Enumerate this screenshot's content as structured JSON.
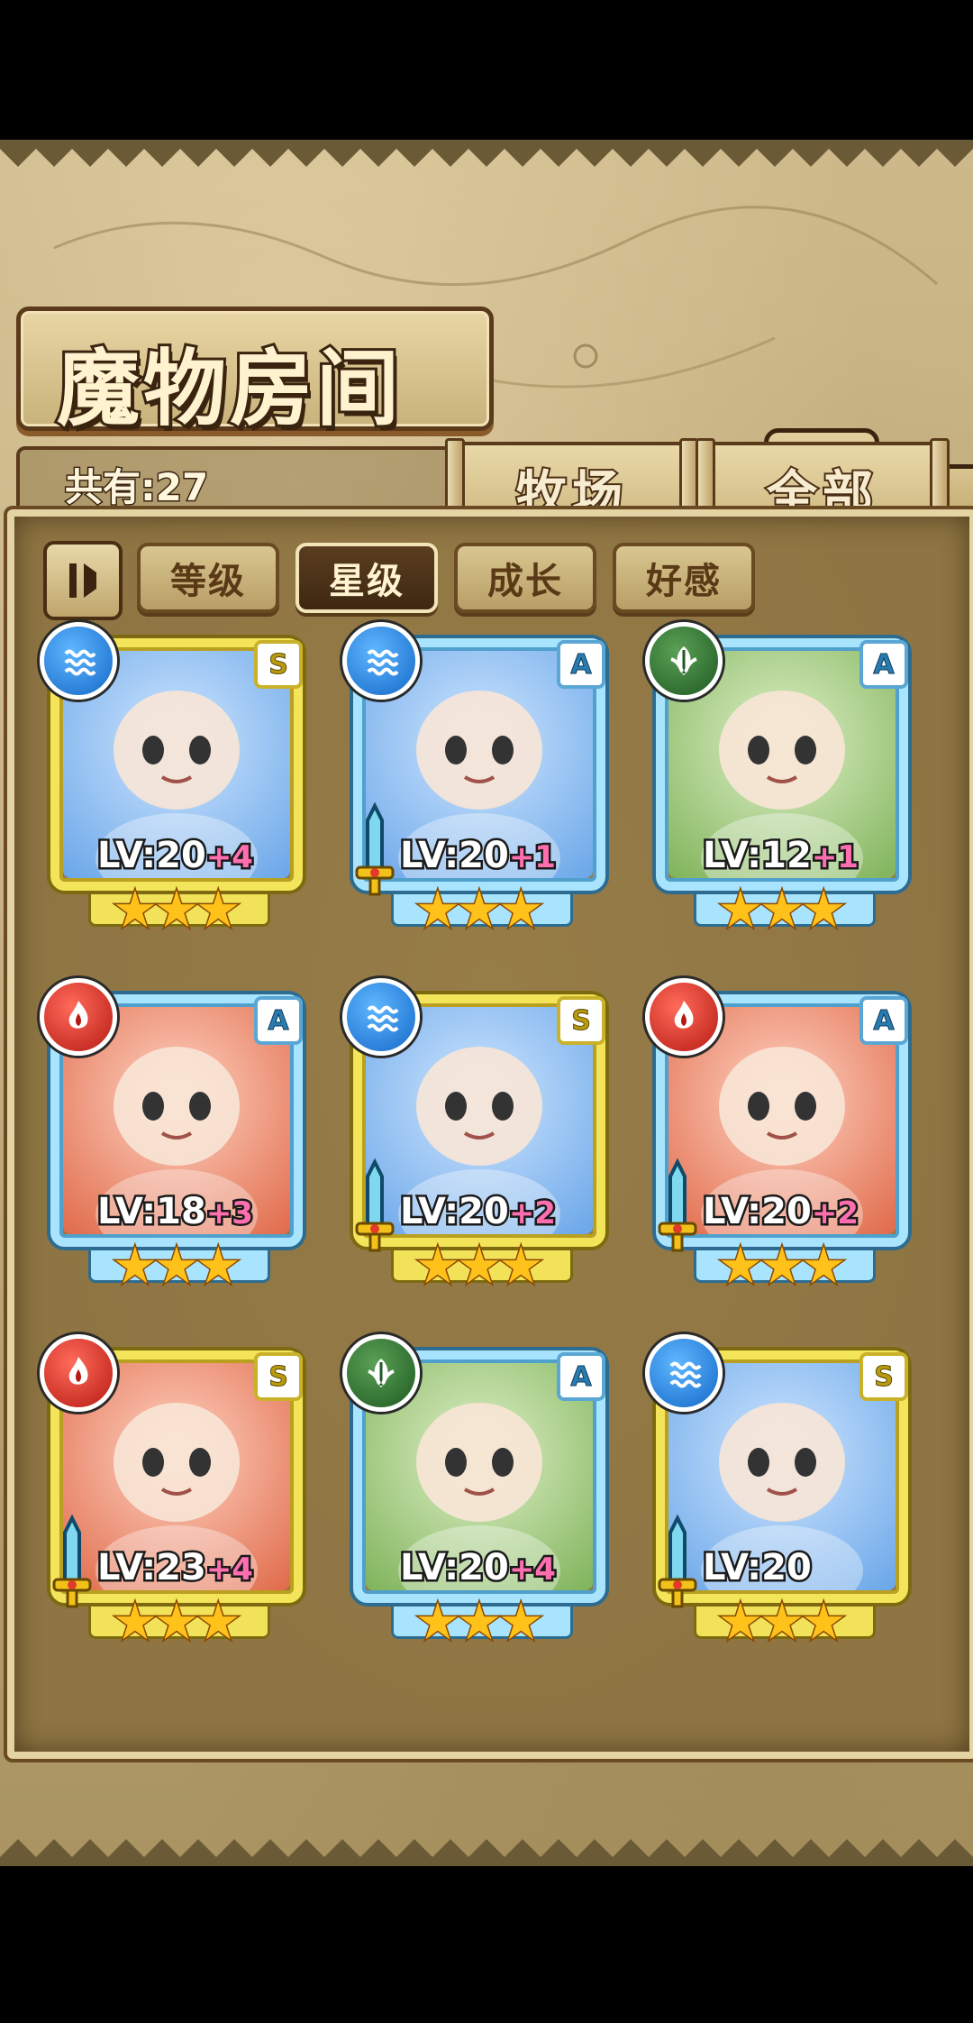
{
  "title": "魔物房间",
  "count_label": "共有:27",
  "tabs": [
    {
      "label": "牧场"
    },
    {
      "label": "全部"
    }
  ],
  "filters": [
    {
      "label": "等级",
      "active": false
    },
    {
      "label": "星级",
      "active": true
    },
    {
      "label": "成长",
      "active": false
    },
    {
      "label": "好感",
      "active": false
    }
  ],
  "monsters": [
    {
      "element": "water",
      "rank": "S",
      "level": "LV:20",
      "plus": "+4",
      "stars": 3,
      "weapon": false
    },
    {
      "element": "water",
      "rank": "A",
      "level": "LV:20",
      "plus": "+1",
      "stars": 3,
      "weapon": true
    },
    {
      "element": "leaf",
      "rank": "A",
      "level": "LV:12",
      "plus": "+1",
      "stars": 3,
      "weapon": false
    },
    {
      "element": "fire",
      "rank": "A",
      "level": "LV:18",
      "plus": "+3",
      "stars": 3,
      "weapon": false
    },
    {
      "element": "water",
      "rank": "S",
      "level": "LV:20",
      "plus": "+2",
      "stars": 3,
      "weapon": true
    },
    {
      "element": "fire",
      "rank": "A",
      "level": "LV:20",
      "plus": "+2",
      "stars": 3,
      "weapon": true
    },
    {
      "element": "fire",
      "rank": "S",
      "level": "LV:23",
      "plus": "+4",
      "stars": 3,
      "weapon": true
    },
    {
      "element": "leaf",
      "rank": "A",
      "level": "LV:20",
      "plus": "+4",
      "stars": 3,
      "weapon": false
    },
    {
      "element": "water",
      "rank": "S",
      "level": "LV:20",
      "plus": "",
      "stars": 3,
      "weapon": true
    }
  ],
  "colors": {
    "water": "#1468c8",
    "fire": "#b71a12",
    "leaf": "#1f5a22",
    "rank_s": "#f3e45a",
    "rank_a": "#a9e4ff",
    "plus": "#ff6fb0"
  }
}
